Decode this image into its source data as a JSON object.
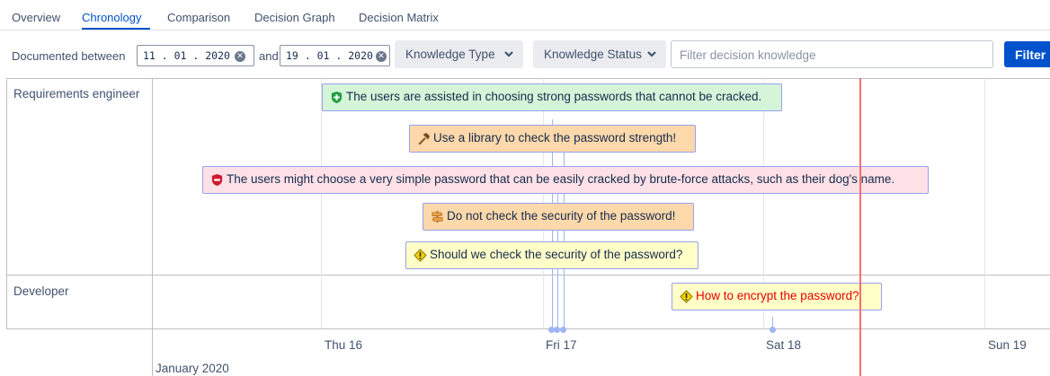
{
  "tabs": [
    {
      "label": "Overview"
    },
    {
      "label": "Chronology",
      "active": true
    },
    {
      "label": "Comparison"
    },
    {
      "label": "Decision Graph"
    },
    {
      "label": "Decision Matrix"
    }
  ],
  "filter": {
    "documented_between_label": "Documented between",
    "start_date": "11 . 01 . 2020",
    "and_label": "and",
    "end_date": "19 . 01 . 2020",
    "knowledge_type_label": "Knowledge Type",
    "knowledge_status_label": "Knowledge Status",
    "search_placeholder": "Filter decision knowledge",
    "filter_button": "Filter"
  },
  "timeline": {
    "groups": [
      {
        "label": "Requirements engineer"
      },
      {
        "label": "Developer"
      }
    ],
    "axis": {
      "days": [
        "Thu 16",
        "Fri 17",
        "Sat 18",
        "Sun 19"
      ],
      "month": "January 2020"
    },
    "items": [
      {
        "type": "pro",
        "text": "The users are assisted in choosing strong passwords that cannot be cracked."
      },
      {
        "type": "decision",
        "text": "Use a library to check the password strength!"
      },
      {
        "type": "con",
        "text": "The users might choose a very simple password that can be easily cracked by brute-force attacks, such as their dog's name."
      },
      {
        "type": "alternative",
        "text": "Do not check the security of the password!"
      },
      {
        "type": "issue",
        "text": "Should we check the security of the password?"
      },
      {
        "type": "issue",
        "text": "How to encrypt the password?",
        "highlighted": true
      }
    ],
    "colors": {
      "pro": "#d4f5d8",
      "decision": "#fdd8aa",
      "con": "#fde1e6",
      "issue": "#ffffc8",
      "current_time_line": "#ff6b6b",
      "link_line": "#9fb4f3",
      "unresolved_text": "#e60000"
    }
  }
}
